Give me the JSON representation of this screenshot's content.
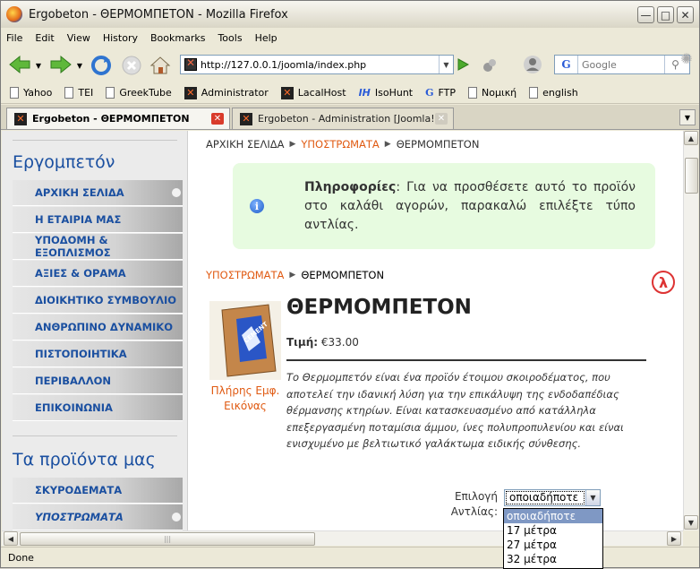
{
  "window": {
    "title": "Ergobeton - ΘΕΡΜΟΜΠΕΤΟΝ - Mozilla Firefox"
  },
  "menu": [
    "File",
    "Edit",
    "View",
    "History",
    "Bookmarks",
    "Tools",
    "Help"
  ],
  "urlbar": {
    "url": "http://127.0.0.1/joomla/index.php"
  },
  "search": {
    "placeholder": "Google",
    "engine": "G"
  },
  "bookmarks": [
    "Yahoo",
    "TEI",
    "GreekTube",
    "Administrator",
    "LacalHost",
    "IsoHunt",
    "FTP",
    "Νομική",
    "english"
  ],
  "tabs": [
    {
      "label": "Ergobeton - ΘΕΡΜΟΜΠΕΤΟΝ",
      "active": true
    },
    {
      "label": "Ergobeton - Administration [Joomla!]",
      "active": false
    }
  ],
  "sidebar": {
    "title1": "Εργομπετόν",
    "menu1": [
      "ΑΡΧΙΚΗ ΣΕΛΙΔΑ",
      "Η ΕΤΑΙΡΙΑ ΜΑΣ",
      "ΥΠΟΔΟΜΗ & ΕΞΟΠΛΙΣΜΟΣ",
      "ΑΞΙΕΣ & ΟΡΑΜΑ",
      "ΔΙΟΙΚΗΤΙΚΟ ΣΥΜΒΟΥΛΙΟ",
      "ΑΝΘΡΩΠΙΝΟ ΔΥΝΑΜΙΚΟ",
      "ΠΙΣΤΟΠΟΙΗΤΙΚΑ",
      "ΠΕΡΙΒΑΛΛΟΝ",
      "ΕΠΙΚΟΙΝΩΝΙΑ"
    ],
    "title2": "Τα προϊόντα μας",
    "menu2": [
      "ΣΚΥΡΟΔΕΜΑΤΑ",
      "ΥΠΟΣΤΡΩΜΑΤΑ"
    ]
  },
  "breadcrumb": {
    "home": "ΑΡΧΙΚΗ ΣΕΛΙΔΑ",
    "category": "ΥΠΟΣΤΡΩΜΑΤΑ",
    "current": "ΘΕΡΜΟΜΠΕΤΟΝ"
  },
  "info": {
    "label": "Πληροφορίες",
    "text": ": Για να προσθέσετε αυτό το προϊόν στο καλάθι αγορών, παρακαλώ επιλέξτε τύπο αντλίας."
  },
  "product": {
    "category": "ΥΠΟΣΤΡΩΜΑΤΑ",
    "name": "ΘΕΡΜΟΜΠΕΤΟΝ",
    "price_label": "Τιμή:",
    "price": "€33.00",
    "image_caption": "Πλήρης Εμφ. Εικόνας",
    "image_text": "CEMENT",
    "description": "Το Θερμομπετόν είναι ένα προϊόν έτοιμου σκοιροδέματος, που αποτελεί την ιδανική λύση για την επικάλυψη της ενδοδαπέδιας θέρμανσης κτηρίων. Είναι κατασκευασμένο από κατάλληλα επεξεργασμένη ποταμίσια άμμου, ίνες πολυπροπυλενίου και είναι ενισχυμένο με βελτιωτικό γαλάκτωμα ειδικής σύνθεσης.",
    "option_label": "Επιλογή Αντλίας:",
    "option_selected": "οποιαδήποτε",
    "options": [
      "οποιαδήποτε",
      "17 μέτρα",
      "27 μέτρα",
      "32 μέτρα"
    ]
  },
  "status": "Done"
}
